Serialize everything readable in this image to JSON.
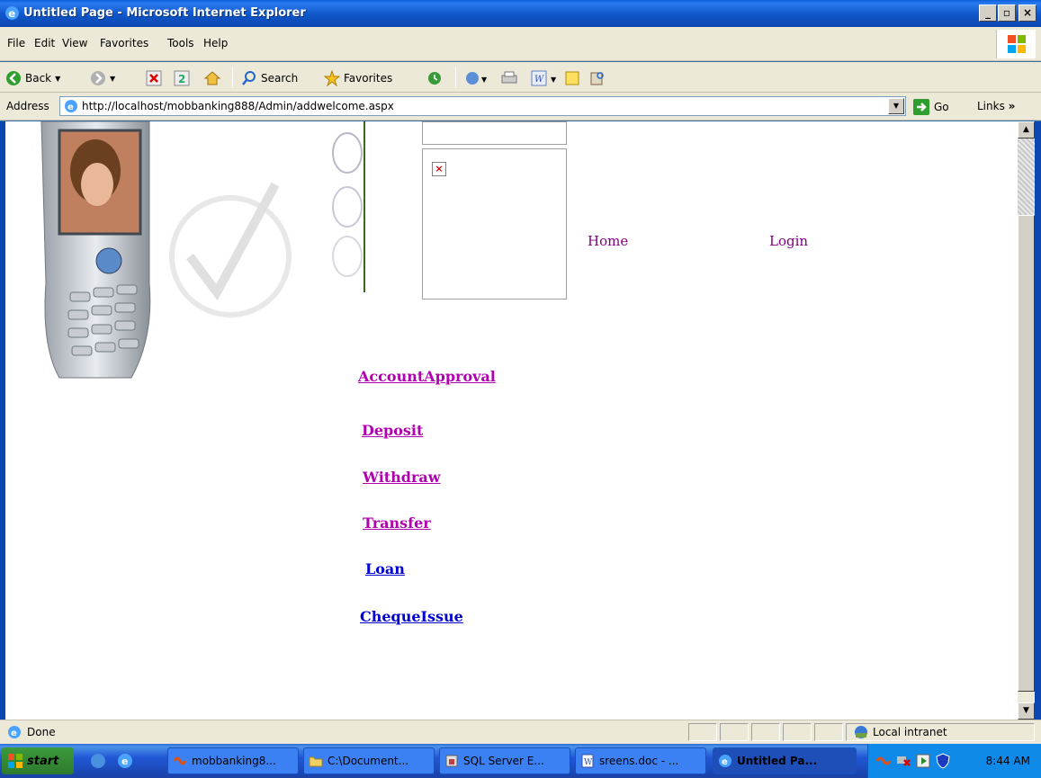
{
  "window": {
    "title": "Untitled Page - Microsoft Internet Explorer",
    "buttons": [
      "_",
      "▫",
      "×"
    ]
  },
  "menu": {
    "items": [
      "File",
      "Edit",
      "View",
      "Favorites",
      "Tools",
      "Help"
    ]
  },
  "toolbar": {
    "back_label": "Back",
    "search_label": "Search",
    "favorites_label": "Favorites"
  },
  "address": {
    "label": "Address",
    "url": "http://localhost/mobbanking888/Admin/addwelcome.aspx",
    "go_label": "Go",
    "links_label": "Links"
  },
  "page": {
    "nav": {
      "home": "Home",
      "login": "Login"
    },
    "admin_links": [
      {
        "label": "AccountApproval",
        "color": "#b000b0"
      },
      {
        "label": "Deposit",
        "color": "#b000b0"
      },
      {
        "label": "Withdraw",
        "color": "#b000b0"
      },
      {
        "label": "Transfer",
        "color": "#b000b0"
      },
      {
        "label": "Loan",
        "color": "#0000d0"
      },
      {
        "label": "ChequeIssue",
        "color": "#0000d0"
      }
    ]
  },
  "status": {
    "text": "Done",
    "zone": "Local intranet"
  },
  "taskbar": {
    "start_label": "start",
    "tasks": [
      {
        "label": "mobbanking8...",
        "icon": "vs-icon"
      },
      {
        "label": "C:\\Document...",
        "icon": "folder-icon"
      },
      {
        "label": "SQL Server E...",
        "icon": "sql-icon"
      },
      {
        "label": "sreens.doc - ...",
        "icon": "word-icon"
      },
      {
        "label": "Untitled Pa...",
        "icon": "ie-icon",
        "active": true
      }
    ],
    "clock": "8:44 AM"
  }
}
